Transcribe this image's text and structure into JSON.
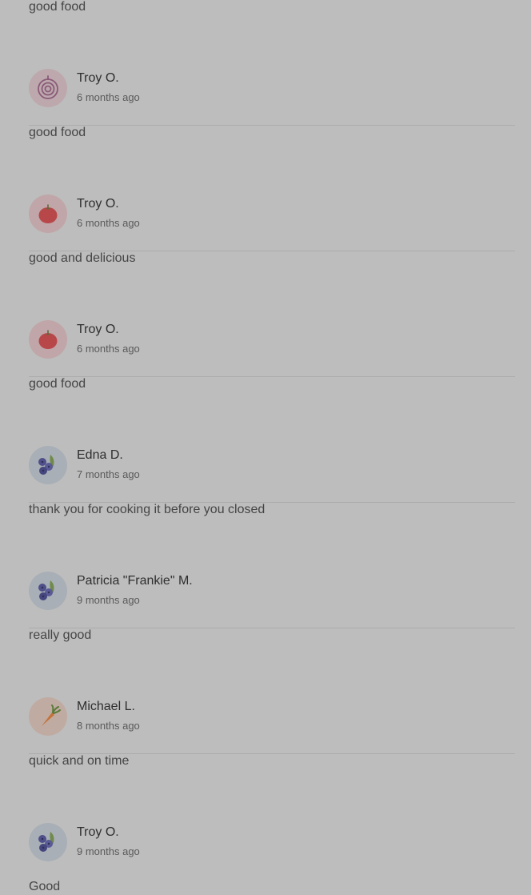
{
  "prev_review": {
    "comment": "good food"
  },
  "reviews": [
    {
      "name": "Troy O.",
      "time": "6 months ago",
      "comment": "good food",
      "avatar_icon": "onion-icon"
    },
    {
      "name": "Troy O.",
      "time": "6 months ago",
      "comment": "good and delicious",
      "avatar_icon": "tomato-icon"
    },
    {
      "name": "Troy O.",
      "time": "6 months ago",
      "comment": "good food",
      "avatar_icon": "tomato-icon"
    },
    {
      "name": "Edna D.",
      "time": "7 months ago",
      "comment": "thank you for cooking it before you closed",
      "avatar_icon": "blueberries-icon"
    },
    {
      "name": "Patricia \"Frankie\" M.",
      "time": "9 months ago",
      "comment": "really good",
      "avatar_icon": "blueberries-icon"
    },
    {
      "name": "Michael L.",
      "time": "8 months ago",
      "comment": "quick and on time",
      "avatar_icon": "carrot-icon"
    },
    {
      "name": "Troy O.",
      "time": "9 months ago",
      "comment": "Good",
      "avatar_icon": "blueberries-icon"
    }
  ]
}
